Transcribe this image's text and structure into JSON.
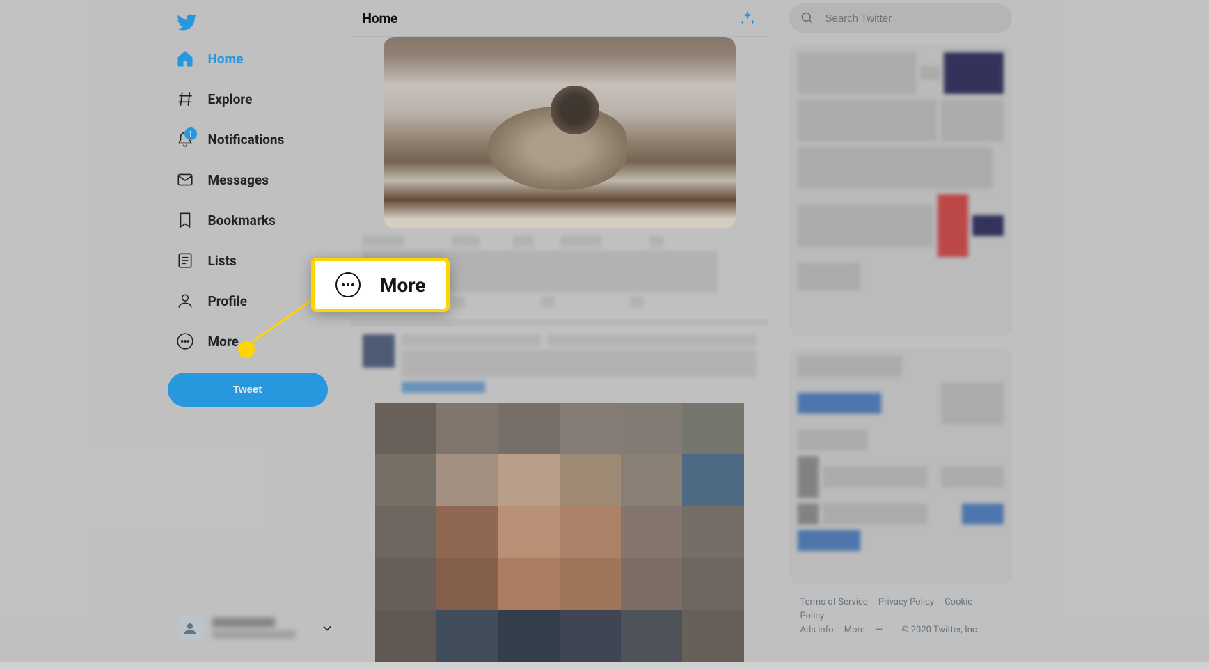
{
  "header": {
    "title": "Home"
  },
  "nav": {
    "home": "Home",
    "explore": "Explore",
    "notifications": "Notifications",
    "notifications_badge": "1",
    "messages": "Messages",
    "bookmarks": "Bookmarks",
    "lists": "Lists",
    "profile": "Profile",
    "more": "More"
  },
  "tweet_button": "Tweet",
  "search": {
    "placeholder": "Search Twitter"
  },
  "callout": {
    "label": "More"
  },
  "footer": {
    "terms": "Terms of Service",
    "privacy": "Privacy Policy",
    "cookie": "Cookie Policy",
    "ads": "Ads info",
    "more": "More",
    "copyright": "© 2020 Twitter, Inc."
  }
}
